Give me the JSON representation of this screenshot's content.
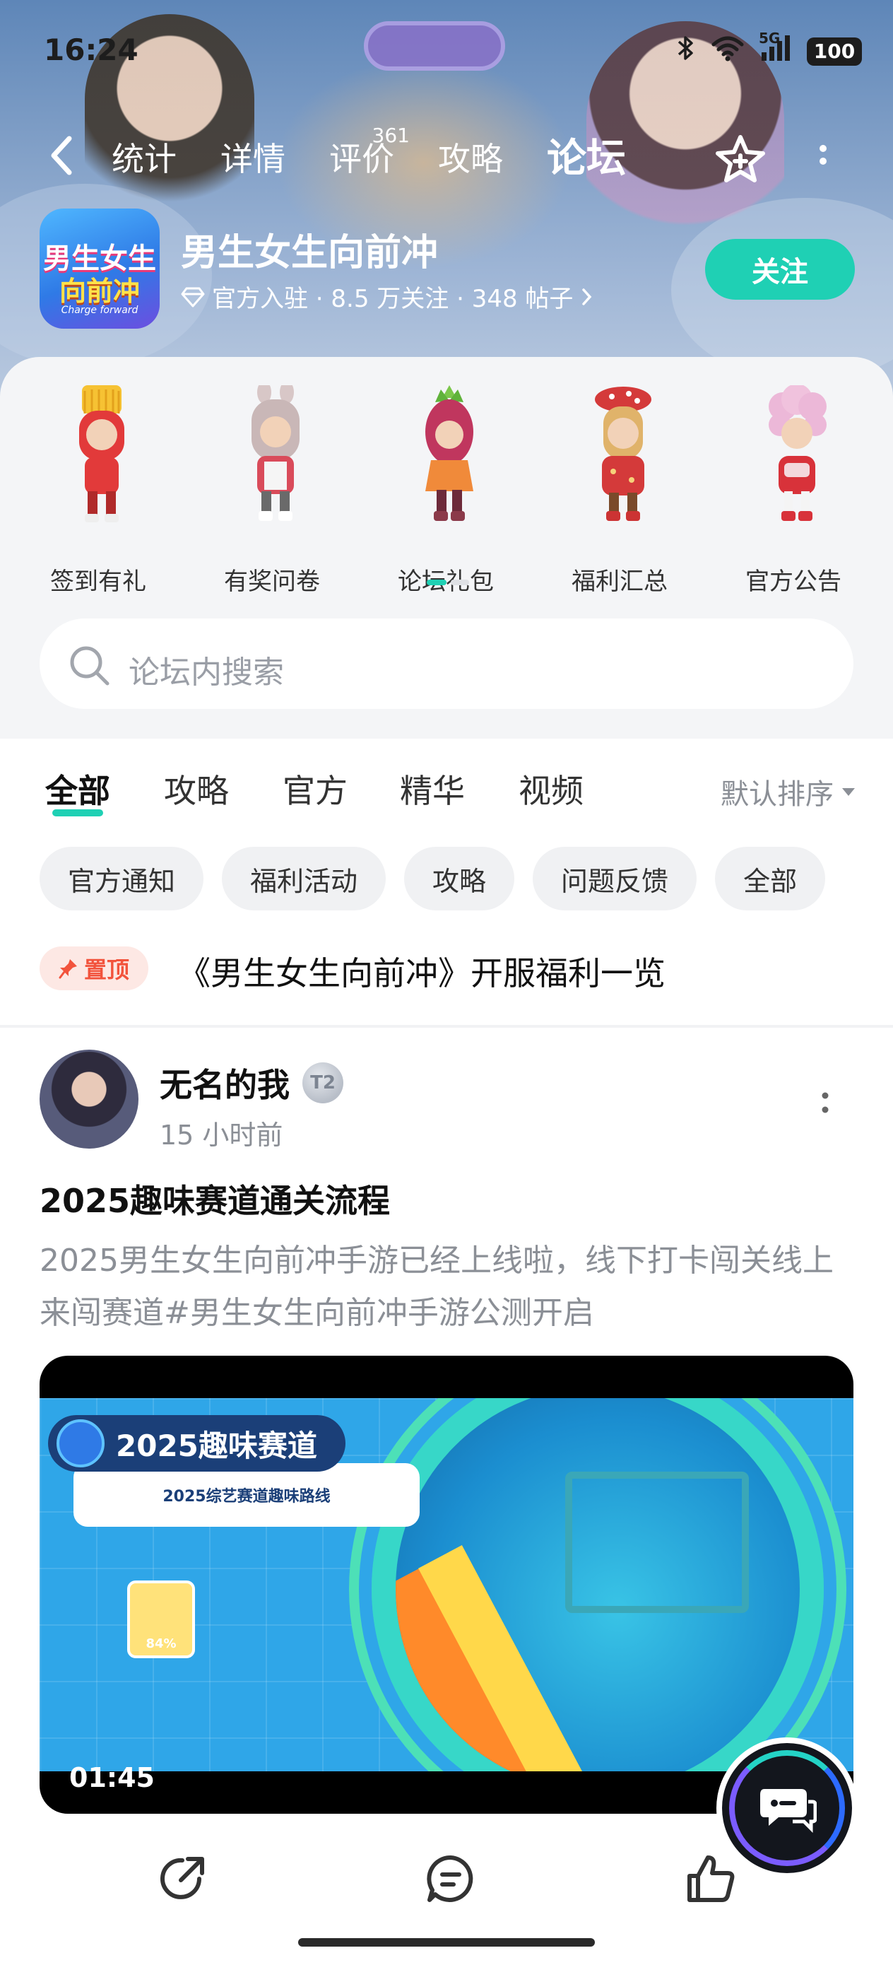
{
  "status_bar": {
    "time": "16:24",
    "network": "5G",
    "battery": "100"
  },
  "nav": {
    "tabs": [
      {
        "label": "统计"
      },
      {
        "label": "详情"
      },
      {
        "label": "评价",
        "badge": "361"
      },
      {
        "label": "攻略"
      },
      {
        "label": "论坛",
        "active": true
      }
    ]
  },
  "game": {
    "icon_text_1": "男生女生",
    "icon_text_2": "向前冲",
    "icon_text_3": "Charge forward",
    "name": "男生女生向前冲",
    "meta": "官方入驻 · 8.5 万关注 · 348 帖子",
    "follow_label": "关注"
  },
  "quick_links": [
    {
      "label": "签到有礼",
      "color": "#e23a3a"
    },
    {
      "label": "有奖问卷",
      "color": "#d94b5a"
    },
    {
      "label": "论坛礼包",
      "color": "#c0365e"
    },
    {
      "label": "福利汇总",
      "color": "#d43a3a"
    },
    {
      "label": "官方公告",
      "color": "#e7a3c8"
    }
  ],
  "search": {
    "placeholder": "论坛内搜索"
  },
  "feed_tabs": [
    {
      "label": "全部",
      "active": true
    },
    {
      "label": "攻略"
    },
    {
      "label": "官方"
    },
    {
      "label": "精华"
    },
    {
      "label": "视频"
    }
  ],
  "sort_label": "默认排序",
  "chips": [
    "官方通知",
    "福利活动",
    "攻略",
    "问题反馈",
    "全部"
  ],
  "pinned": {
    "badge": "置顶",
    "title": "《男生女生向前冲》开服福利一览"
  },
  "post": {
    "author": "无名的我",
    "level": "T2",
    "time": "15 小时前",
    "title": "2025趣味赛道通关流程",
    "body": "2025男生女生向前冲手游已经上线啦，线下打卡闯关线上来闯赛道#男生女生向前冲手游公测开启",
    "video": {
      "tag": "2025趣味赛道",
      "subtitle": "2025综艺赛道趣味路线",
      "progress": "84%",
      "duration": "01:45"
    }
  },
  "colors": {
    "accent": "#1fd0b4",
    "pin_red": "#f2533c"
  }
}
